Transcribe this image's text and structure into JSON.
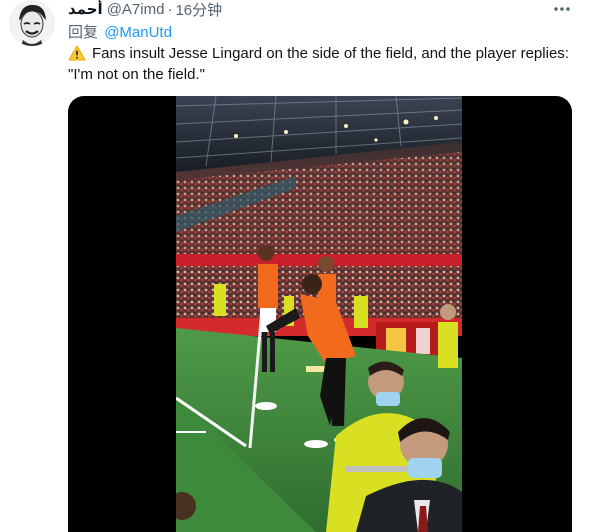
{
  "tweet": {
    "display_name": "أحمد",
    "handle": "@A7imd",
    "separator": "·",
    "time": "16分钟",
    "reply_prefix": "回复",
    "reply_target": "@ManUtd",
    "text": "Fans insult Jesse Lingard on the side of the field, and the player replies: \"I'm not on the field.\"",
    "emoji_icon": "warning-icon",
    "more_icon": "more-options-icon"
  },
  "colors": {
    "link": "#1d9bf0",
    "secondary_text": "#536471",
    "primary_text": "#0f1419",
    "vest_orange": "#f26a1b",
    "steward_yellow": "#d9e021",
    "pitch_green": "#3c8a3c",
    "crowd_red": "#b32828"
  }
}
